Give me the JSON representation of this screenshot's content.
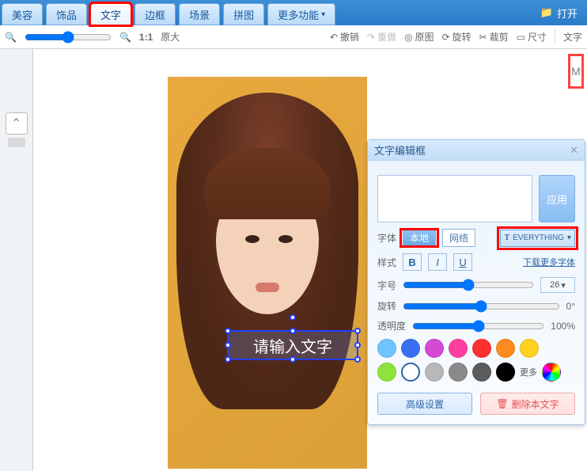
{
  "topbar": {
    "tabs": [
      "美容",
      "饰品",
      "文字",
      "边框",
      "场景",
      "拼图",
      "更多功能"
    ],
    "active_index": 2,
    "open_label": "打开"
  },
  "toolbar": {
    "ratio_label": "1:1",
    "zoom_original": "原大",
    "undo": "撤销",
    "redo": "重做",
    "original": "原图",
    "rotate": "旋转",
    "crop": "裁剪",
    "size": "尺寸",
    "right_tab": "文字"
  },
  "right": {
    "m_label": "M"
  },
  "textbox": {
    "placeholder": "请输入文字"
  },
  "panel": {
    "title": "文字编辑框",
    "apply": "应用",
    "font_label": "字体",
    "seg_local": "本地",
    "seg_net": "网络",
    "font_name": "EVERYTHING",
    "style_label": "样式",
    "more_fonts": "下载更多字体",
    "size_label": "字号",
    "size_value": "26",
    "rotate_label": "旋转",
    "rotate_value": "0°",
    "opacity_label": "透明度",
    "opacity_value": "100%",
    "more_color": "更多",
    "adv": "高级设置",
    "del": "删除本文字",
    "colors_row1": [
      "#6fc4ff",
      "#3a6ff0",
      "#d648d6",
      "#ff3fa0",
      "#ff3030",
      "#ff8a1f",
      "#ffd21f"
    ],
    "colors_row2": [
      "#8fe33a",
      "#ffffff",
      "#b8b8b8",
      "#8a8a8a",
      "#5c5c5c",
      "#000000"
    ]
  }
}
